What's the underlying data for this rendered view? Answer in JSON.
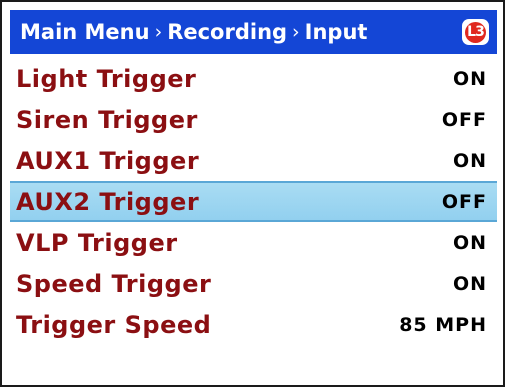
{
  "header": {
    "breadcrumb": [
      "Main Menu",
      "Recording",
      "Input"
    ],
    "separator": "›",
    "logo_text": "L3",
    "background_color": "#1446d6"
  },
  "menu": {
    "selected_index": 3,
    "items": [
      {
        "label": "Light Trigger",
        "value": "ON"
      },
      {
        "label": "Siren Trigger",
        "value": "OFF"
      },
      {
        "label": "AUX1 Trigger",
        "value": "ON"
      },
      {
        "label": "AUX2 Trigger",
        "value": "OFF"
      },
      {
        "label": "VLP Trigger",
        "value": "ON"
      },
      {
        "label": "Speed Trigger",
        "value": "ON"
      },
      {
        "label": "Trigger Speed",
        "value": "85 MPH"
      }
    ],
    "label_color": "#8b0f12",
    "highlight_color": "#a9dcf3"
  }
}
